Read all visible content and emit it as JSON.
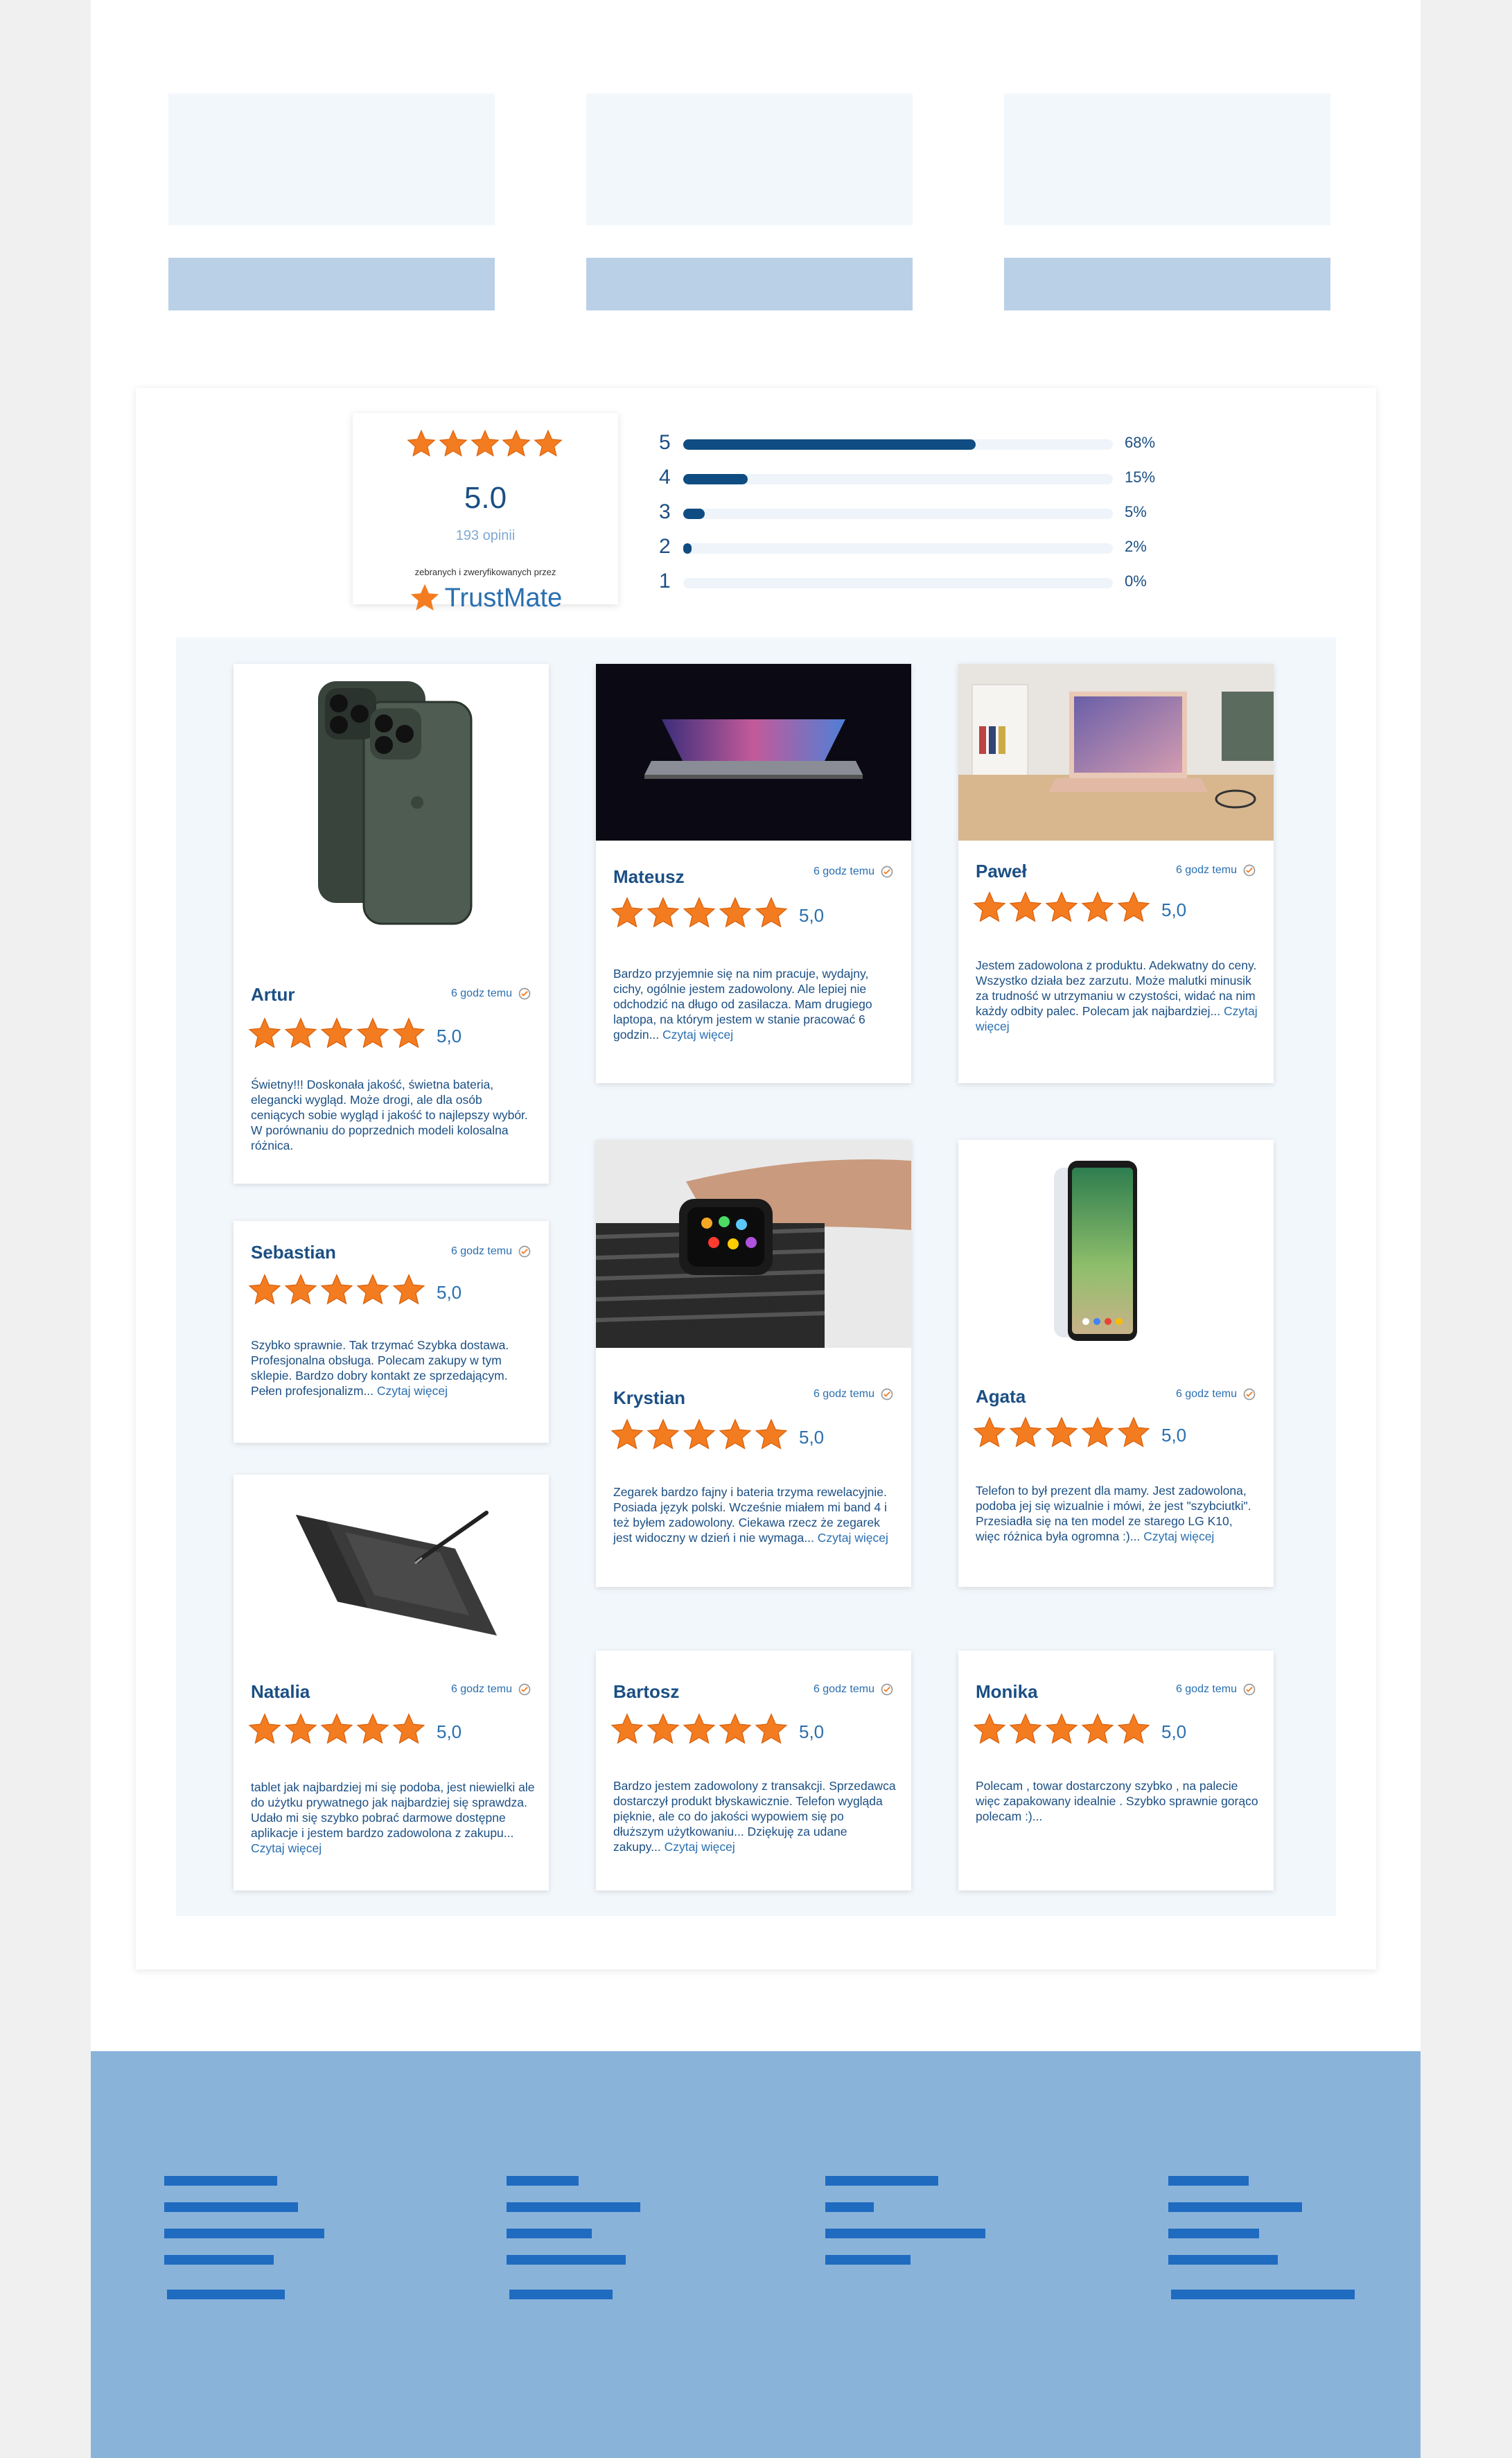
{
  "colors": {
    "accent": "#0f4c81",
    "star": "#f47c20",
    "link": "#2a6fb0",
    "panel": "#f2f7fc",
    "footer": "#8ab3da"
  },
  "summary": {
    "score": "5.0",
    "count": "193 opinii",
    "verified": "zebranych i zweryfikowanych przez",
    "brand": "TrustMate",
    "brand_icon": "star-logo-icon",
    "stars": 5
  },
  "distribution": [
    {
      "label": "5",
      "percent": "68%",
      "value": 68
    },
    {
      "label": "4",
      "percent": "15%",
      "value": 15
    },
    {
      "label": "3",
      "percent": "5%",
      "value": 5
    },
    {
      "label": "2",
      "percent": "2%",
      "value": 2
    },
    {
      "label": "1",
      "percent": "0%",
      "value": 0
    }
  ],
  "reviews": [
    {
      "name": "Artur",
      "time": "6 godz temu",
      "score": "5,0",
      "image": "iphone-image",
      "text": "Świetny!!! Doskonała jakość, świetna bateria, elegancki wygląd. Może drogi, ale dla osób ceniących sobie wygląd i jakość to najlepszy wybór. W porównaniu do poprzednich modeli  kolosalna różnica.",
      "more": ""
    },
    {
      "name": "Mateusz",
      "time": "6 godz temu",
      "score": "5,0",
      "image": "macbook-pro-image",
      "text": "Bardzo przyjemnie się na nim pracuje, wydajny, cichy, ogólnie jestem zadowolony. Ale lepiej nie odchodzić na długo od zasilacza. Mam drugiego laptopa, na którym jestem w stanie pracować 6 godzin...",
      "more": "Czytaj więcej"
    },
    {
      "name": "Paweł",
      "time": "6 godz temu",
      "score": "5,0",
      "image": "macbook-air-image",
      "text": "Jestem zadowolona z produktu. Adekwatny do ceny. Wszystko działa bez zarzutu. Może malutki minusik za trudność w utrzymaniu w czystości, widać na nim każdy odbity palec. Polecam jak najbardziej...",
      "more": "Czytaj więcej"
    },
    {
      "name": "Sebastian",
      "time": "6 godz temu",
      "score": "5,0",
      "image": "",
      "text": "Szybko sprawnie. Tak trzymać Szybka dostawa. Profesjonalna obsługa. Polecam zakupy w tym sklepie. Bardzo dobry kontakt ze sprzedającym. Pełen profesjonalizm...",
      "more": "Czytaj więcej"
    },
    {
      "name": "Krystian",
      "time": "6 godz temu",
      "score": "5,0",
      "image": "smartwatch-image",
      "text": "Zegarek bardzo fajny i bateria trzyma rewelacyjnie. Posiada język polski. Wcześnie miałem mi band 4 i też byłem zadowolony. Ciekawa rzecz że zegarek jest widoczny w dzień i nie wymaga...",
      "more": "Czytaj więcej"
    },
    {
      "name": "Agata",
      "time": "6 godz temu",
      "score": "5,0",
      "image": "smartphone-image",
      "text": "Telefon to był prezent dla mamy. Jest zadowolona, podoba jej się wizualnie i mówi, że jest \"szybciutki\". Przesiadła się na ten model ze starego LG K10, więc różnica była ogromna :)...",
      "more": "Czytaj więcej"
    },
    {
      "name": "Natalia",
      "time": "6 godz temu",
      "score": "5,0",
      "image": "graphics-tablet-image",
      "text": "tablet jak najbardziej mi się podoba, jest niewielki ale do użytku prywatnego jak najbardziej się sprawdza. Udało mi się szybko pobrać darmowe dostępne aplikacje i jestem bardzo zadowolona z zakupu...",
      "more": "Czytaj więcej"
    },
    {
      "name": "Bartosz",
      "time": "6 godz temu",
      "score": "5,0",
      "image": "",
      "text": "Bardzo jestem zadowolony z transakcji. Sprzedawca dostarczył produkt błyskawicznie. Telefon wygląda pięknie, ale co do jakości wypowiem się po dłuższym użytkowaniu... Dziękuję za udane zakupy...",
      "more": "Czytaj więcej"
    },
    {
      "name": "Monika",
      "time": "6 godz temu",
      "score": "5,0",
      "image": "",
      "text": "Polecam , towar dostarczony szybko , na palecie więc zapakowany idealnie . Szybko sprawnie gorąco polecam :)...",
      "more": ""
    }
  ]
}
